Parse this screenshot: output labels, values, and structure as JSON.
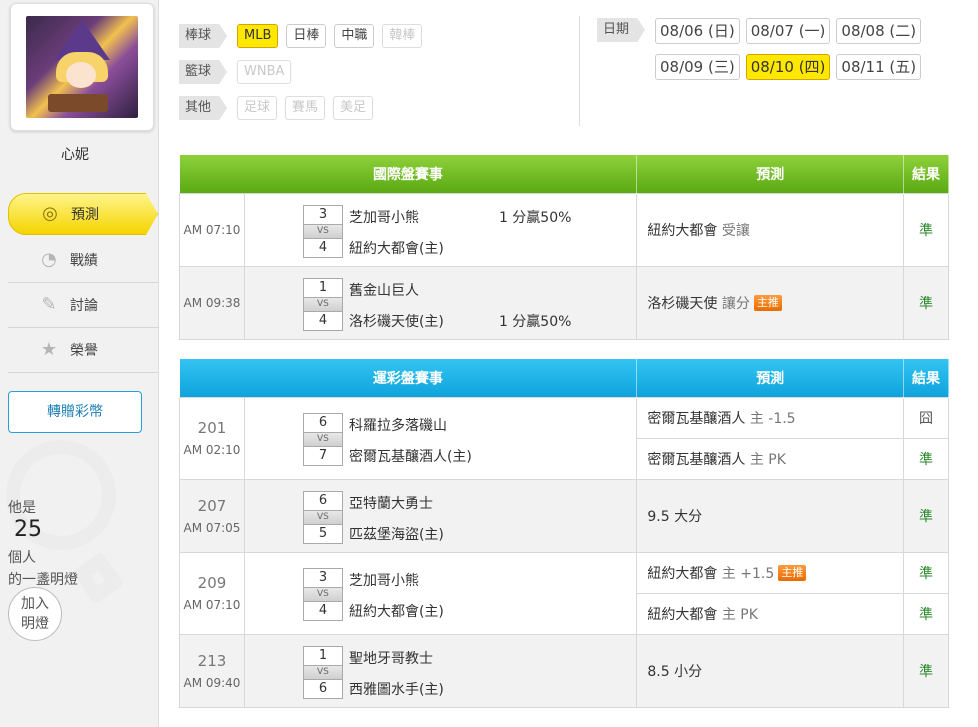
{
  "user": {
    "name": "心妮"
  },
  "nav": [
    {
      "label": "預測",
      "icon": "target-icon"
    },
    {
      "label": "戰績",
      "icon": "chart-icon"
    },
    {
      "label": "討論",
      "icon": "chat-icon"
    },
    {
      "label": "榮譽",
      "icon": "medal-icon"
    }
  ],
  "transfer_label": "轉贈彩幣",
  "light": {
    "prefix": "他是",
    "count": "25",
    "suffix": "個人",
    "line2": "的一盞明燈",
    "join_line1": "加入",
    "join_line2": "明燈"
  },
  "filters": {
    "baseball": {
      "label": "棒球",
      "options": [
        "MLB",
        "日棒",
        "中職",
        "韓棒"
      ]
    },
    "basketball": {
      "label": "籃球",
      "options": [
        "WNBA"
      ]
    },
    "other": {
      "label": "其他",
      "options": [
        "足球",
        "賽馬",
        "美足"
      ]
    },
    "selected": "MLB"
  },
  "date": {
    "label": "日期",
    "options": [
      "08/06 (日)",
      "08/07 (一)",
      "08/08 (二)",
      "08/09 (三)",
      "08/10 (四)",
      "08/11 (五)"
    ],
    "selected": "08/10 (四)"
  },
  "intl_table": {
    "headers": {
      "game": "國際盤賽事",
      "pred": "預測",
      "result": "結果"
    },
    "rows": [
      {
        "time": "AM 07:10",
        "away": {
          "score": "3",
          "name": "芝加哥小熊"
        },
        "vs": "VS",
        "home": {
          "score": "4",
          "name": "紐約大都會(主)"
        },
        "odd": "1 分贏50%",
        "odd_row": "away",
        "pred_team": "紐約大都會",
        "pred_extra": "受讓",
        "badge": "",
        "result": "準"
      },
      {
        "time": "AM 09:38",
        "away": {
          "score": "1",
          "name": "舊金山巨人"
        },
        "vs": "VS",
        "home": {
          "score": "4",
          "name": "洛杉磯天使(主)"
        },
        "odd": "1 分贏50%",
        "odd_row": "home",
        "pred_team": "洛杉磯天使",
        "pred_extra": "讓分",
        "badge": "主推",
        "result": "準"
      }
    ]
  },
  "sport_table": {
    "headers": {
      "game": "運彩盤賽事",
      "pred": "預測",
      "result": "結果"
    },
    "rows": [
      {
        "no": "201",
        "time": "AM 02:10",
        "away": {
          "score": "6",
          "name": "科羅拉多落磯山"
        },
        "vs": "VS",
        "home": {
          "score": "7",
          "name": "密爾瓦基釀酒人(主)"
        },
        "preds": [
          {
            "team": "密爾瓦基釀酒人",
            "extra": "主 -1.5",
            "badge": "",
            "result": "囧"
          },
          {
            "team": "密爾瓦基釀酒人",
            "extra": "主 PK",
            "badge": "",
            "result": "準"
          }
        ]
      },
      {
        "no": "207",
        "time": "AM 07:05",
        "away": {
          "score": "6",
          "name": "亞特蘭大勇士"
        },
        "vs": "VS",
        "home": {
          "score": "5",
          "name": "匹茲堡海盜(主)"
        },
        "preds": [
          {
            "team": "9.5 大分",
            "extra": "",
            "badge": "",
            "result": "準"
          }
        ]
      },
      {
        "no": "209",
        "time": "AM 07:10",
        "away": {
          "score": "3",
          "name": "芝加哥小熊"
        },
        "vs": "VS",
        "home": {
          "score": "4",
          "name": "紐約大都會(主)"
        },
        "preds": [
          {
            "team": "紐約大都會",
            "extra": "主 +1.5",
            "badge": "主推",
            "result": "準"
          },
          {
            "team": "紐約大都會",
            "extra": "主 PK",
            "badge": "",
            "result": "準"
          }
        ]
      },
      {
        "no": "213",
        "time": "AM 09:40",
        "away": {
          "score": "1",
          "name": "聖地牙哥教士"
        },
        "vs": "VS",
        "home": {
          "score": "6",
          "name": "西雅圖水手(主)"
        },
        "preds": [
          {
            "team": "8.5 小分",
            "extra": "",
            "badge": "",
            "result": "準"
          }
        ]
      }
    ]
  },
  "colors": {
    "accent_yellow": "#ffe800",
    "green_header": "#6bbb1e",
    "blue_header": "#12a8e0",
    "result_green": "#2a8a2a",
    "badge_orange": "#f07a10"
  }
}
